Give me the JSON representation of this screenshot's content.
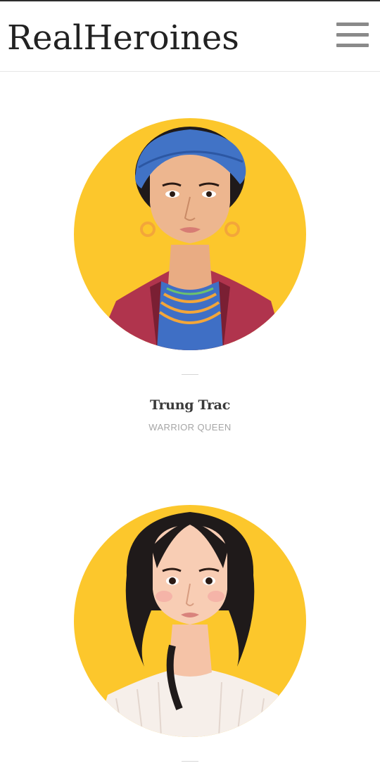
{
  "header": {
    "logo_part1": "Real",
    "logo_part2": "Heroines",
    "menu_icon": "hamburger-menu-icon"
  },
  "heroines": [
    {
      "name": "Trung Trac",
      "role": "WARRIOR QUEEN"
    }
  ],
  "colors": {
    "portrait_background": "#FCC72C",
    "text_dark": "#3a3a3a",
    "text_muted": "#a6a6a6",
    "menu_icon": "#8a8a8a"
  }
}
